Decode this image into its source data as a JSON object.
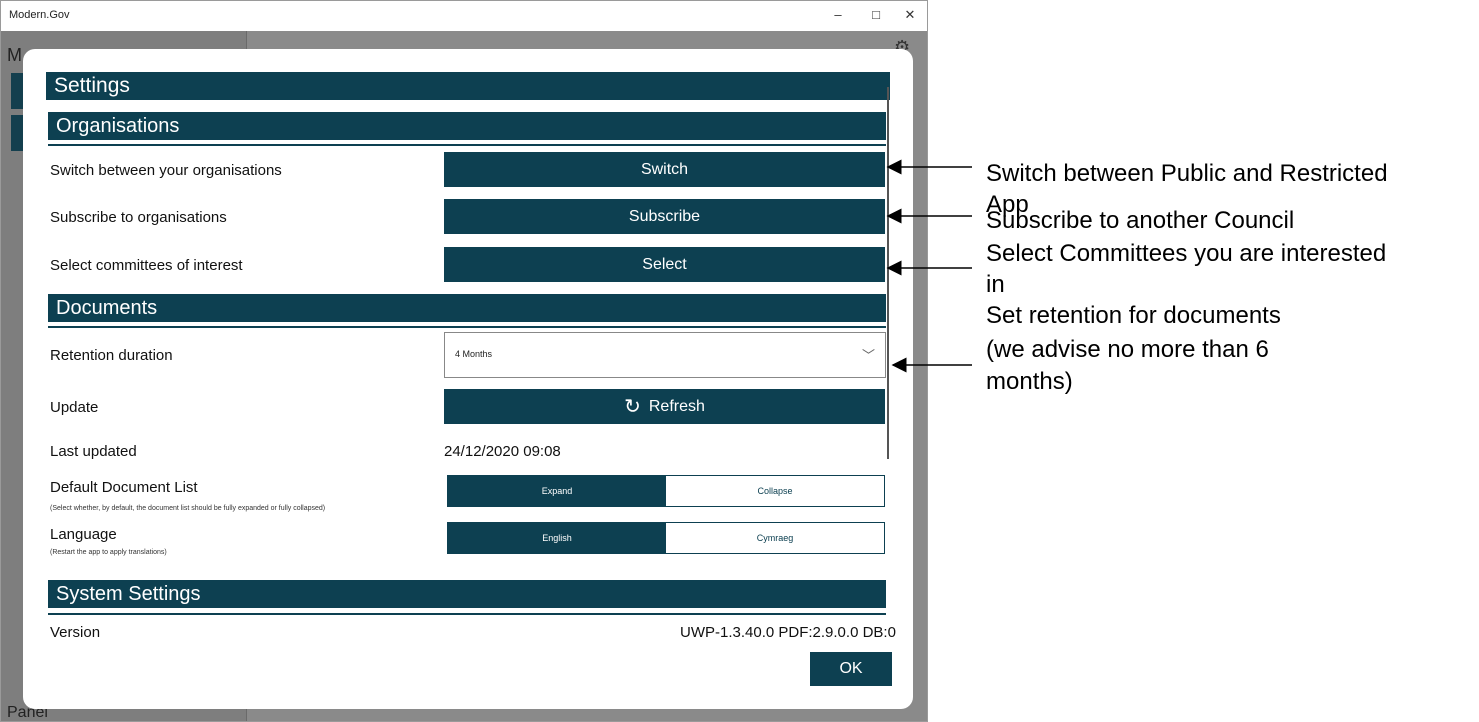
{
  "window": {
    "title": "Modern.Gov",
    "minimize": "–",
    "maximize": "□",
    "close": "✕"
  },
  "background": {
    "letter": "M",
    "panel_label": "Panel"
  },
  "dialog": {
    "title": "Settings",
    "organisations": {
      "header": "Organisations",
      "switch_label": "Switch between your organisations",
      "switch_button": "Switch",
      "subscribe_label": "Subscribe to organisations",
      "subscribe_button": "Subscribe",
      "select_label": "Select committees of interest",
      "select_button": "Select"
    },
    "documents": {
      "header": "Documents",
      "retention_label": "Retention duration",
      "retention_value": "4 Months",
      "update_label": "Update",
      "refresh_button": "Refresh",
      "last_updated_label": "Last updated",
      "last_updated_value": "24/12/2020 09:08",
      "default_list_label": "Default Document List",
      "default_list_sub": "(Select whether, by default, the document list should be fully expanded or fully collapsed)",
      "expand": "Expand",
      "collapse": "Collapse",
      "language_label": "Language",
      "language_sub": "(Restart the app to apply translations)",
      "english": "English",
      "cymraeg": "Cymraeg"
    },
    "system": {
      "header": "System Settings",
      "version_label": "Version",
      "version_value": "UWP-1.3.40.0 PDF:2.9.0.0 DB:0"
    },
    "ok_button": "OK"
  },
  "annotations": {
    "switch_note_1": "Switch between Public and Restricted",
    "switch_note_2": "App",
    "subscribe_note": "Subscribe to another Council",
    "select_note_1": "Select Committees you are interested",
    "select_note_2": "in",
    "retention_note_1": "Set retention for documents",
    "retention_note_2": "(we advise no more than 6",
    "retention_note_3": "months)"
  },
  "colors": {
    "accent": "#0d4051"
  }
}
